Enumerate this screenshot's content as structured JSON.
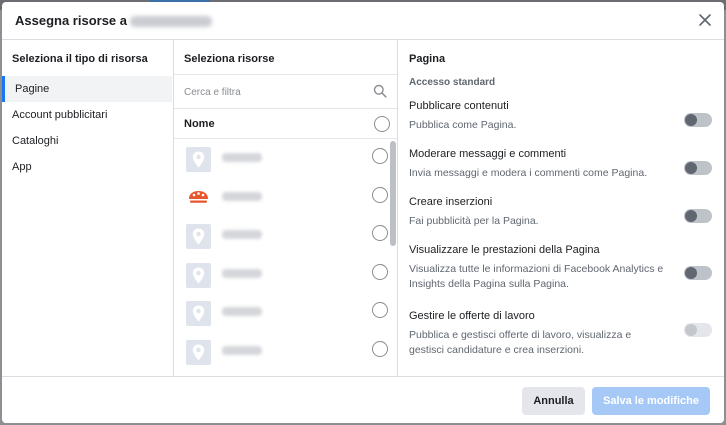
{
  "dialog": {
    "title": "Assegna risorse a",
    "close_icon": "close-icon"
  },
  "types": {
    "heading": "Seleziona il tipo di risorsa",
    "items": [
      {
        "label": "Pagine",
        "active": true
      },
      {
        "label": "Account pubblicitari",
        "active": false
      },
      {
        "label": "Cataloghi",
        "active": false
      },
      {
        "label": "App",
        "active": false
      }
    ]
  },
  "resources": {
    "heading": "Seleziona risorse",
    "search_placeholder": "Cerca e filtra",
    "search_icon": "search-icon",
    "column_label": "Nome",
    "items": [
      {
        "icon": "location-pin-icon"
      },
      {
        "icon": "brand-logo-icon"
      },
      {
        "icon": "location-pin-icon"
      },
      {
        "icon": "location-pin-icon"
      },
      {
        "icon": "location-pin-icon"
      },
      {
        "icon": "location-pin-icon"
      }
    ]
  },
  "permissions": {
    "heading": "Pagina",
    "section": "Accesso standard",
    "items": [
      {
        "title": "Pubblicare contenuti",
        "description": "Pubblica come Pagina.",
        "enabled": false,
        "disabled": false
      },
      {
        "title": "Moderare messaggi e commenti",
        "description": "Invia messaggi e modera i commenti come Pagina.",
        "enabled": false,
        "disabled": false
      },
      {
        "title": "Creare inserzioni",
        "description": "Fai pubblicità per la Pagina.",
        "enabled": false,
        "disabled": false
      },
      {
        "title": "Visualizzare le prestazioni della Pagina",
        "description": "Visualizza tutte le informazioni di Facebook Analytics e Insights della Pagina sulla Pagina.",
        "enabled": false,
        "disabled": false
      },
      {
        "title": "Gestire le offerte di lavoro",
        "description": "Pubblica e gestisci offerte di lavoro, visualizza e gestisci candidature e crea inserzioni.",
        "enabled": false,
        "disabled": true
      }
    ]
  },
  "footer": {
    "cancel_label": "Annulla",
    "save_label": "Salva le modifiche"
  },
  "colors": {
    "accent": "#1877f2",
    "save_disabled": "#a6c8f6"
  }
}
